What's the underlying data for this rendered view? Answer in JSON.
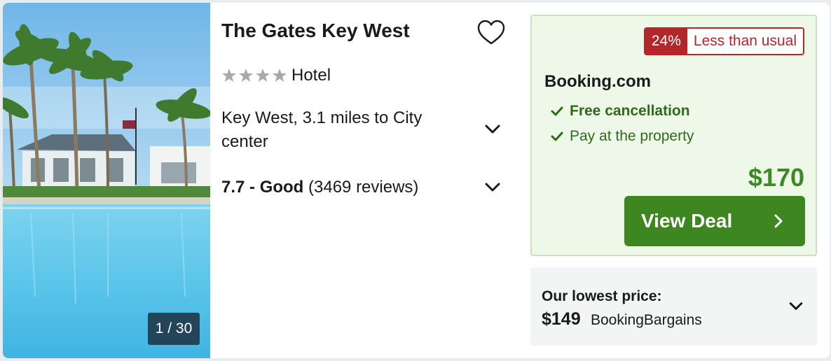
{
  "hotel": {
    "name": "The Gates Key West",
    "star_rating": 4,
    "type": "Hotel",
    "location": "Key West, 3.1 miles to City center",
    "rating_score": "7.7 - Good",
    "rating_reviews": "(3469 reviews)"
  },
  "photo": {
    "counter": "1 / 30"
  },
  "deal": {
    "discount_pct": "24%",
    "discount_text": "Less than usual",
    "provider": "Booking.com",
    "features": [
      "Free cancellation",
      "Pay at the property"
    ],
    "price": "$170",
    "cta_label": "View Deal"
  },
  "lowest": {
    "label": "Our lowest price:",
    "price": "$149",
    "provider": "BookingBargains"
  },
  "icons": {
    "favorite": "heart-outline-icon",
    "expand": "chevron-down-icon",
    "check": "check-icon",
    "cta_arrow": "chevron-right-icon",
    "star": "star-icon"
  },
  "colors": {
    "deal_green": "#3e8620",
    "deal_bg": "#eef8e9",
    "badge_red": "#b3262a",
    "price_green": "#3b8a22"
  }
}
